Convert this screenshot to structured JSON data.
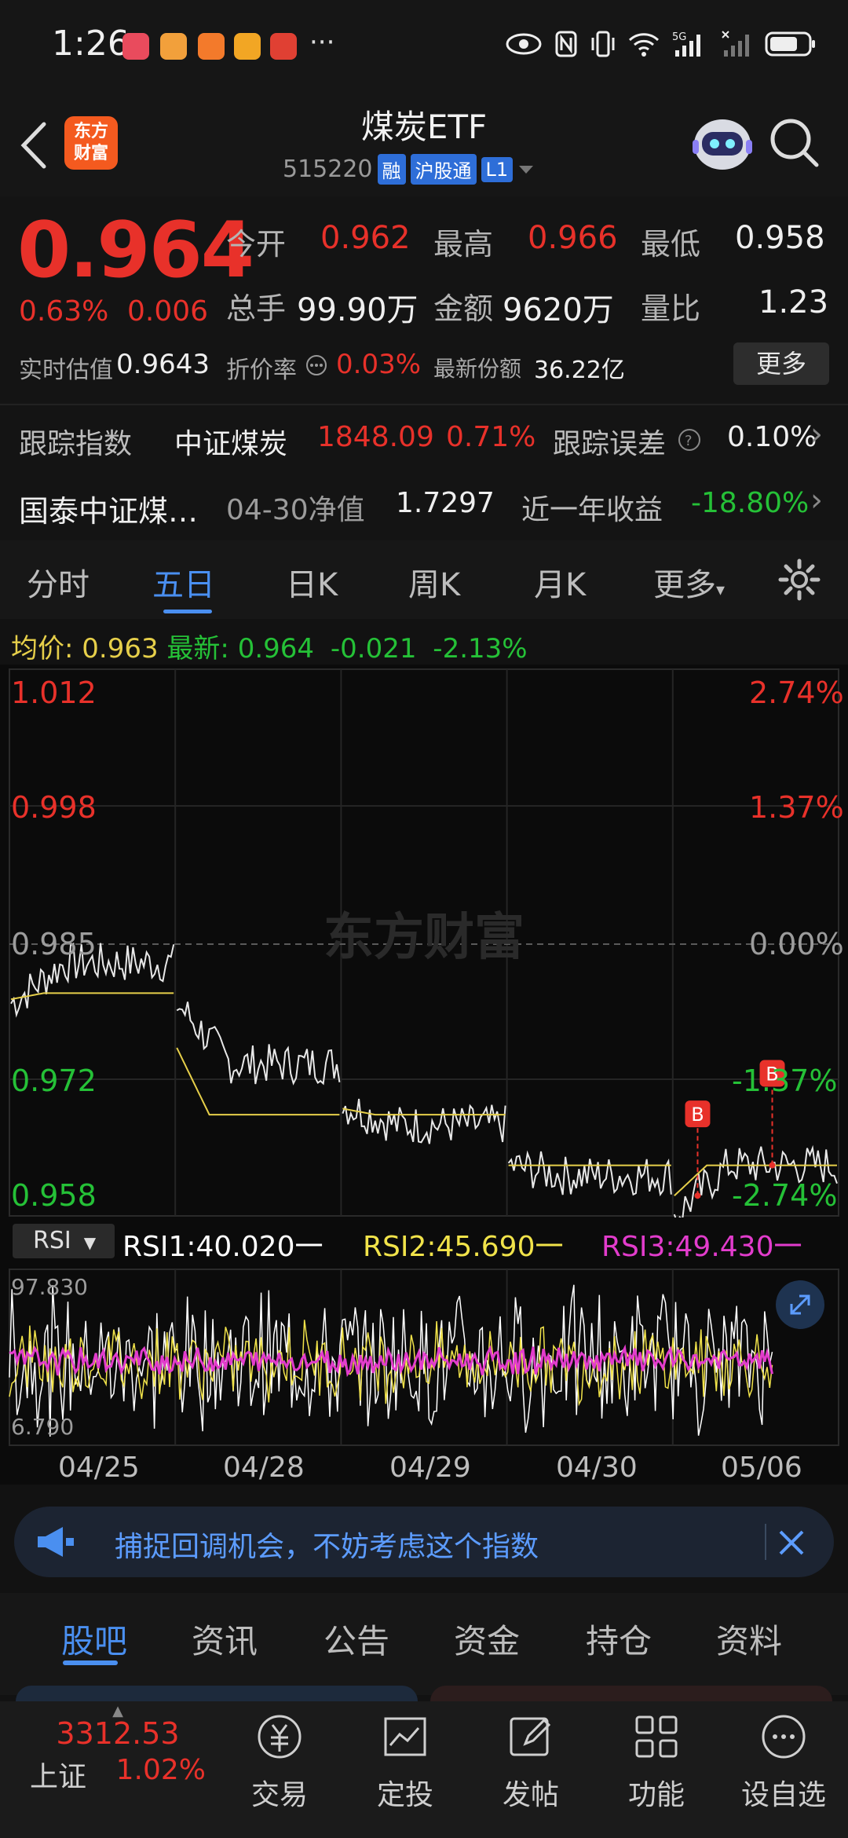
{
  "status": {
    "time": "1:26",
    "network": "5G"
  },
  "header": {
    "back_label": "",
    "logo_text_line1": "东方",
    "logo_text_line2": "财富",
    "title": "煤炭ETF",
    "code": "515220",
    "tags": [
      "融",
      "沪股通",
      "L1"
    ]
  },
  "quote": {
    "price": "0.964",
    "change_pct": "0.63%",
    "change": "0.006",
    "open_label": "今开",
    "open": "0.962",
    "high_label": "最高",
    "high": "0.966",
    "low_label": "最低",
    "low": "0.958",
    "volume_label": "总手",
    "volume": "99.90万",
    "amount_label": "金额",
    "amount": "9620万",
    "ratio_label": "量比",
    "ratio": "1.23",
    "est_label": "实时估值",
    "est": "0.9643",
    "premium_label": "折价率",
    "premium": "0.03%",
    "shares_label": "最新份额",
    "shares": "36.22亿",
    "more_label": "更多"
  },
  "tracking": {
    "label": "跟踪指数",
    "index": "中证煤炭",
    "index_value": "1848.09",
    "index_pct": "0.71%",
    "error_label": "跟踪误差",
    "error": "0.10%",
    "fund_name": "国泰中证煤…",
    "nav_label": "04-30净值",
    "nav": "1.7297",
    "year_label": "近一年收益",
    "year": "-18.80%"
  },
  "tabs": [
    "分时",
    "五日",
    "日K",
    "周K",
    "月K",
    "更多"
  ],
  "chart": {
    "avg_label": "均价:",
    "avg": "0.963",
    "latest_label": "最新:",
    "latest": "0.964",
    "latest_chg": "-0.021",
    "latest_pct": "-2.13%",
    "watermark": "东方财富",
    "y_left": [
      "1.012",
      "0.998",
      "0.985",
      "0.972",
      "0.958"
    ],
    "y_right": [
      "2.74%",
      "1.37%",
      "0.00%",
      "-1.37%",
      "-2.74%"
    ],
    "marker": "B",
    "rsi": {
      "label": "RSI",
      "rsi1": "RSI1:40.020一",
      "rsi2": "RSI2:45.690一",
      "rsi3": "RSI3:49.430一",
      "max": "97.830",
      "min": "6.790"
    },
    "x_labels": [
      "04/25",
      "04/28",
      "04/29",
      "04/30",
      "05/06"
    ],
    "colors": {
      "price": "#e8e8e8",
      "avg": "#e6cf4a",
      "rsi1": "#ffffff",
      "rsi2": "#f1e34a",
      "rsi3": "#e23ccc"
    }
  },
  "chart_data": {
    "type": "line",
    "x": [
      "04/25",
      "04/28",
      "04/29",
      "04/30",
      "05/06"
    ],
    "ylim": [
      0.958,
      1.012
    ],
    "series": [
      {
        "values": [
          0.983,
          0.973,
          0.967,
          0.962,
          0.963
        ]
      },
      {
        "values": [
          0.98,
          0.968,
          0.968,
          0.963,
          0.963
        ]
      }
    ]
  },
  "banner": {
    "text": "捕捉回调机会，不妨考虑这个指数"
  },
  "subtabs": [
    "股吧",
    "资讯",
    "公告",
    "资金",
    "持仓",
    "资料"
  ],
  "bottom": {
    "index_value": "3312.53",
    "index_name": "上证",
    "index_pct": "1.02%",
    "items": [
      "交易",
      "定投",
      "发帖",
      "功能",
      "设自选"
    ]
  }
}
